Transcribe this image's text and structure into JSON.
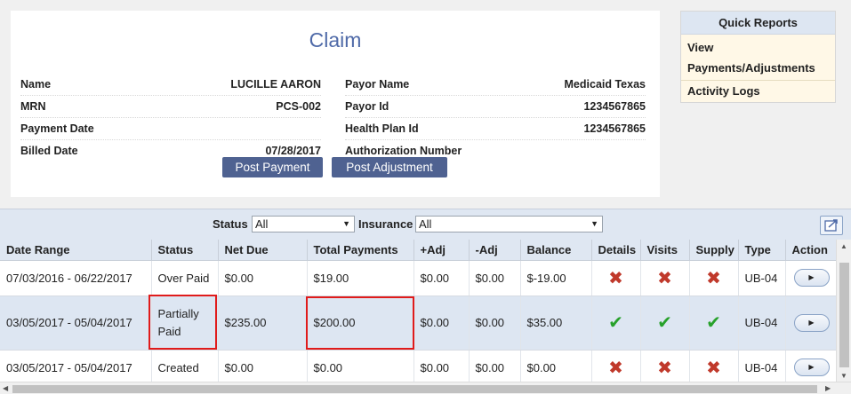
{
  "claim": {
    "title": "Claim",
    "left_fields": [
      {
        "label": "Name",
        "value": "LUCILLE AARON"
      },
      {
        "label": "MRN",
        "value": "PCS-002"
      },
      {
        "label": "Payment Date",
        "value": ""
      },
      {
        "label": "Billed Date",
        "value": "07/28/2017"
      }
    ],
    "right_fields": [
      {
        "label": "Payor Name",
        "value": "Medicaid Texas"
      },
      {
        "label": "Payor Id",
        "value": "1234567865"
      },
      {
        "label": "Health Plan Id",
        "value": "1234567865"
      },
      {
        "label": "Authorization Number",
        "value": ""
      }
    ],
    "post_payment_label": "Post Payment",
    "post_adjustment_label": "Post Adjustment"
  },
  "quick_reports": {
    "title": "Quick Reports",
    "items": [
      "View Payments/Adjustments",
      "Activity Logs"
    ]
  },
  "filters": {
    "status_label": "Status",
    "status_value": "All",
    "insurance_label": "Insurance",
    "insurance_value": "All"
  },
  "table": {
    "columns": [
      "Date Range",
      "Status",
      "Net Due",
      "Total Payments",
      "+Adj",
      "-Adj",
      "Balance",
      "Details",
      "Visits",
      "Supply",
      "Type",
      "Action"
    ],
    "rows": [
      {
        "date_range": "07/03/2016 - 06/22/2017",
        "status": "Over Paid",
        "net_due": "$0.00",
        "total_payments": "$19.00",
        "plus_adj": "$0.00",
        "minus_adj": "$0.00",
        "balance": "$-19.00",
        "details": "x",
        "visits": "x",
        "supply": "x",
        "type": "UB-04"
      },
      {
        "date_range": "03/05/2017 - 05/04/2017",
        "status": "Partially Paid",
        "net_due": "$235.00",
        "total_payments": "$200.00",
        "plus_adj": "$0.00",
        "minus_adj": "$0.00",
        "balance": "$35.00",
        "details": "check",
        "visits": "check",
        "supply": "check",
        "type": "UB-04"
      },
      {
        "date_range": "03/05/2017 - 05/04/2017",
        "status": "Created",
        "net_due": "$0.00",
        "total_payments": "$0.00",
        "plus_adj": "$0.00",
        "minus_adj": "$0.00",
        "balance": "$0.00",
        "details": "x",
        "visits": "x",
        "supply": "x",
        "type": "UB-04"
      }
    ]
  },
  "colors": {
    "accent": "#4f6291",
    "title": "#4f6aa8",
    "error_mark": "#c0392b",
    "success_mark": "#27a12b",
    "highlight": "#e01b1b"
  }
}
